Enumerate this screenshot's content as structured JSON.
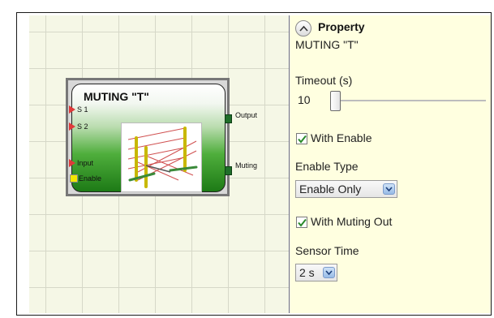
{
  "block": {
    "title": "MUTING \"T\"",
    "inputs": [
      "S 1",
      "S 2",
      "Input",
      "Enable"
    ],
    "outputs": [
      "Output",
      "Muting"
    ]
  },
  "panel": {
    "header": "Property",
    "subtitle": "MUTING \"T\"",
    "timeout_label": "Timeout (s)",
    "timeout_value": "10",
    "timeout_slider_fraction": 0.0,
    "with_enable_label": "With Enable",
    "with_enable_checked": true,
    "enable_type_label": "Enable Type",
    "enable_type_value": "Enable Only",
    "with_muting_out_label": "With Muting Out",
    "with_muting_out_checked": true,
    "sensor_time_label": "Sensor Time",
    "sensor_time_value": "2 s"
  },
  "colors": {
    "panel_bg": "#ffffe0",
    "canvas_bg": "#f5f7e6",
    "block_green": "#1d7a16",
    "input_pin": "#e03a3a",
    "enable_pin": "#f3e800",
    "check": "#2a8a2a"
  },
  "icons": [
    "collapse-up-icon",
    "checkmark-icon",
    "dropdown-arrow-icon",
    "muting-t-picture"
  ]
}
